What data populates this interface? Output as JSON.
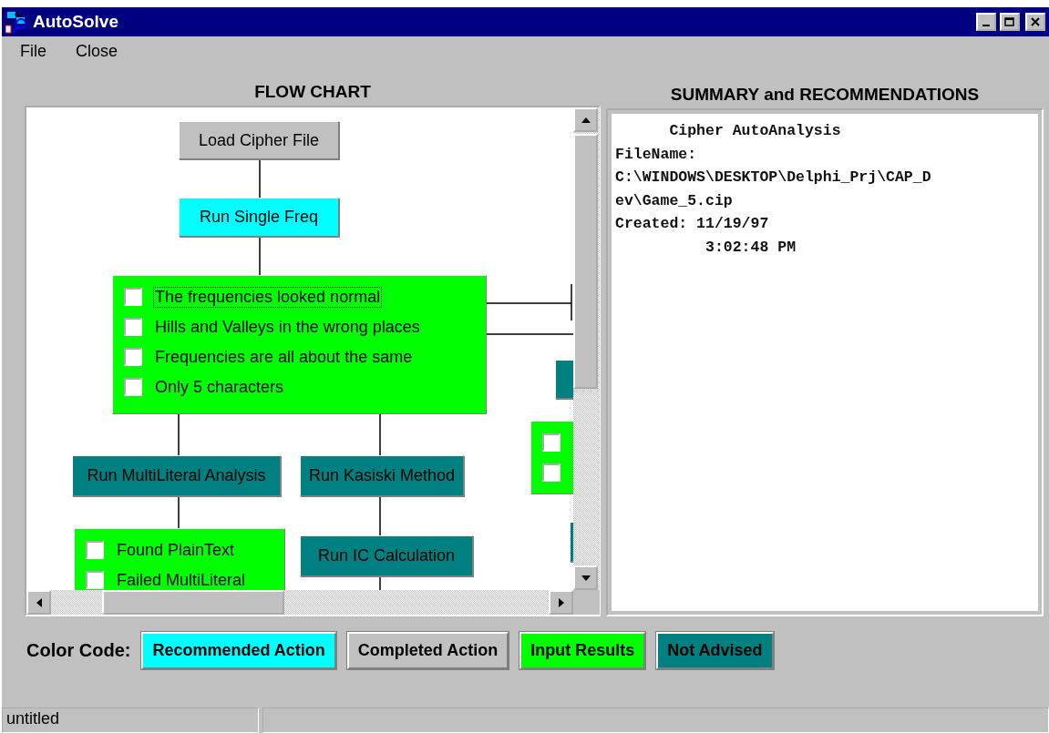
{
  "window": {
    "title": "AutoSolve"
  },
  "menu": [
    "File",
    "Close"
  ],
  "flow_chart": {
    "heading": "FLOW CHART",
    "nodes": [
      {
        "kind": "action",
        "label": "Load Cipher File",
        "color": "#c0c0c0"
      },
      {
        "kind": "action",
        "label": "Run Single Freq",
        "color": "#00ffff"
      },
      {
        "kind": "checklist",
        "items": [
          {
            "label": "The frequencies looked normal",
            "checked": false,
            "focused": true
          },
          {
            "label": "Hills and Valleys in the wrong places",
            "checked": false,
            "focused": false
          },
          {
            "label": "Frequencies are all about the same",
            "checked": false,
            "focused": false
          },
          {
            "label": "Only 5 characters",
            "checked": false,
            "focused": false
          }
        ]
      },
      {
        "kind": "action",
        "label": "Run MultiLiteral Analysis",
        "color": "#008080"
      },
      {
        "kind": "action",
        "label": "Run Kasiski Method",
        "color": "#008080"
      },
      {
        "kind": "checklist",
        "items": [
          {
            "label": "Found PlainText",
            "checked": false,
            "focused": false
          },
          {
            "label": "Failed MultiLiteral",
            "checked": false,
            "focused": false
          }
        ]
      },
      {
        "kind": "action",
        "label": "Run IC Calculation",
        "color": "#008080"
      },
      {
        "kind": "action",
        "color": "#008080"
      },
      {
        "kind": "checklist",
        "items": [
          {
            "checked": false
          },
          {
            "checked": false
          }
        ]
      },
      {
        "kind": "action",
        "color": "#008080"
      }
    ]
  },
  "summary": {
    "heading": "SUMMARY and RECOMMENDATIONS",
    "lines": [
      "      Cipher AutoAnalysis",
      "FileName:",
      "C:\\WINDOWS\\DESKTOP\\Delphi_Prj\\CAP_D",
      "ev\\Game_5.cip",
      "Created: 11/19/97",
      "          3:02:48 PM"
    ]
  },
  "legend": {
    "label": "Color Code:",
    "items": [
      {
        "label": "Recommended Action",
        "color": "#00ffff"
      },
      {
        "label": "Completed Action",
        "color": "#c0c0c0"
      },
      {
        "label": "Input Results",
        "color": "#00ff00"
      },
      {
        "label": "Not Advised",
        "color": "#008080"
      }
    ]
  },
  "status_bar": {
    "text": "untitled"
  }
}
